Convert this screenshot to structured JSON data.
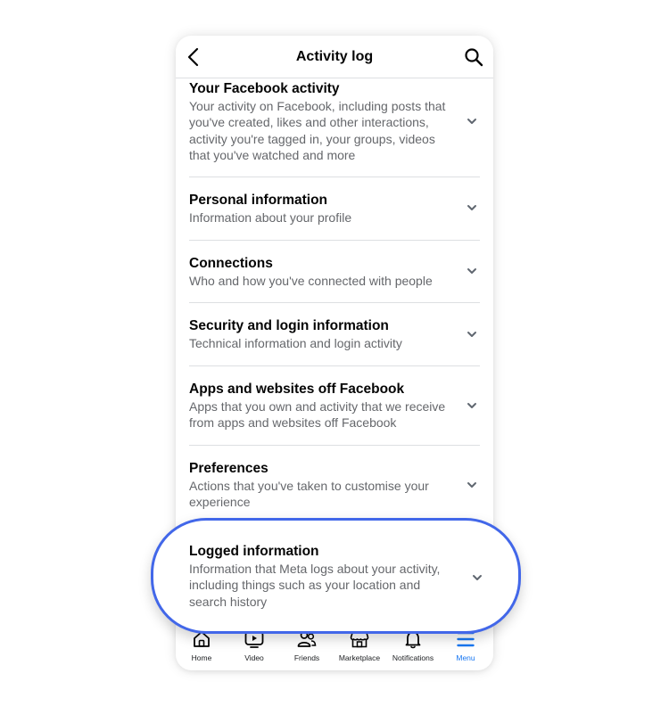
{
  "header": {
    "title": "Activity log",
    "back_icon": "chevron-left-icon",
    "search_icon": "search-icon"
  },
  "sections": [
    {
      "title": "Your Facebook activity",
      "description": "Your activity on Facebook, including posts that you've created, likes and other interactions, activity you're tagged in, your groups, videos that you've watched and more"
    },
    {
      "title": "Personal information",
      "description": "Information about your profile"
    },
    {
      "title": "Connections",
      "description": "Who and how you've connected with people"
    },
    {
      "title": "Security and login information",
      "description": "Technical information and login activity"
    },
    {
      "title": "Apps and websites off Facebook",
      "description": "Apps that you own and activity that we receive from apps and websites off Facebook"
    },
    {
      "title": "Preferences",
      "description": "Actions that you've taken to customise your experience"
    },
    {
      "title": "Logged information",
      "description": "Information that Meta logs about your activity, including things such as your location and search history"
    }
  ],
  "nav": {
    "items": [
      {
        "label": "Home",
        "icon": "home-icon"
      },
      {
        "label": "Video",
        "icon": "video-icon"
      },
      {
        "label": "Friends",
        "icon": "friends-icon"
      },
      {
        "label": "Marketplace",
        "icon": "marketplace-icon"
      },
      {
        "label": "Notifications",
        "icon": "bell-icon"
      },
      {
        "label": "Menu",
        "icon": "menu-icon"
      }
    ],
    "active_color": "#1877f2"
  },
  "colors": {
    "highlight_border": "#4267e9",
    "secondary_text": "#65676b",
    "divider": "#dddfe2"
  }
}
